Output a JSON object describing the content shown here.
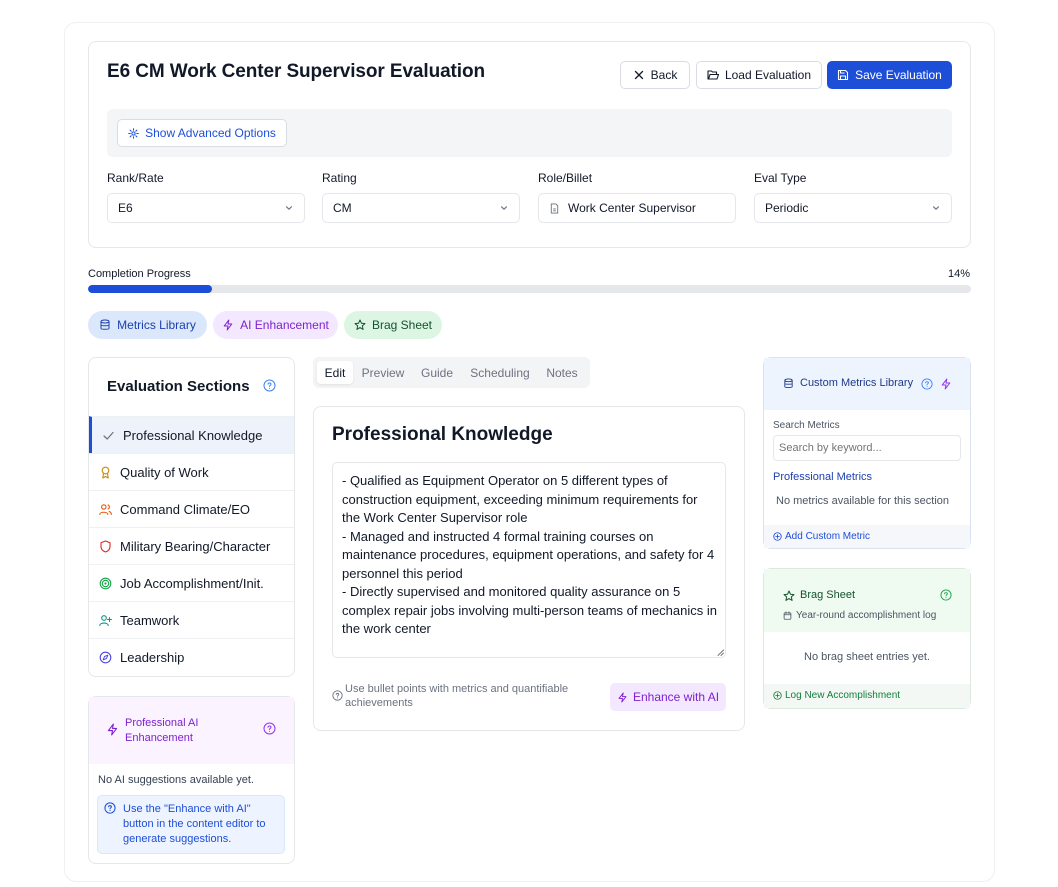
{
  "header": {
    "title": "E6 CM Work Center Supervisor Evaluation",
    "back_label": "Back",
    "load_label": "Load Evaluation",
    "save_label": "Save Evaluation",
    "advanced_label": "Show Advanced Options"
  },
  "fields": {
    "rank": {
      "label": "Rank/Rate",
      "value": "E6"
    },
    "rating": {
      "label": "Rating",
      "value": "CM"
    },
    "role": {
      "label": "Role/Billet",
      "value": "Work Center Supervisor"
    },
    "eval_type": {
      "label": "Eval Type",
      "value": "Periodic"
    }
  },
  "progress": {
    "label": "Completion Progress",
    "percent_text": "14%",
    "fraction": 0.14
  },
  "pills": {
    "metrics": "Metrics Library",
    "ai": "AI Enhancement",
    "brag": "Brag Sheet"
  },
  "sections": {
    "title": "Evaluation Sections",
    "items": [
      {
        "label": "Professional Knowledge",
        "icon": "check-icon"
      },
      {
        "label": "Quality of Work",
        "icon": "award-icon"
      },
      {
        "label": "Command Climate/EO",
        "icon": "users-icon"
      },
      {
        "label": "Military Bearing/Character",
        "icon": "shield-icon"
      },
      {
        "label": "Job Accomplishment/Init.",
        "icon": "target-icon"
      },
      {
        "label": "Teamwork",
        "icon": "user-plus-icon"
      },
      {
        "label": "Leadership",
        "icon": "compass-icon"
      }
    ]
  },
  "ai_panel": {
    "title": "Professional AI Enhancement",
    "empty": "No AI suggestions available yet.",
    "info": "Use the \"Enhance with AI\" button in the content editor to generate suggestions."
  },
  "tabs": [
    "Edit",
    "Preview",
    "Guide",
    "Scheduling",
    "Notes"
  ],
  "editor": {
    "title": "Professional Knowledge",
    "content": "- Qualified as Equipment Operator on 5 different types of construction equipment, exceeding minimum requirements for the Work Center Supervisor role\n- Managed and instructed 4 formal training courses on maintenance procedures, equipment operations, and safety for 4 personnel this period\n- Directly supervised and monitored quality assurance on 5 complex repair jobs involving multi-person teams of mechanics in the work center",
    "hint": "Use bullet points with metrics and quantifiable achievements",
    "enhance_label": "Enhance with AI"
  },
  "metrics_panel": {
    "title": "Custom Metrics Library",
    "search_label": "Search Metrics",
    "search_placeholder": "Search by keyword...",
    "category": "Professional Metrics",
    "empty": "No metrics available for this section",
    "add_label": "Add Custom Metric"
  },
  "brag_panel": {
    "title": "Brag Sheet",
    "subtitle": "Year-round accomplishment log",
    "empty": "No brag sheet entries yet.",
    "log_label": "Log New Accomplishment"
  },
  "colors": {
    "primary": "#1d4ed8",
    "ai_purple": "#7e22ce",
    "brag_green": "#15803d"
  }
}
